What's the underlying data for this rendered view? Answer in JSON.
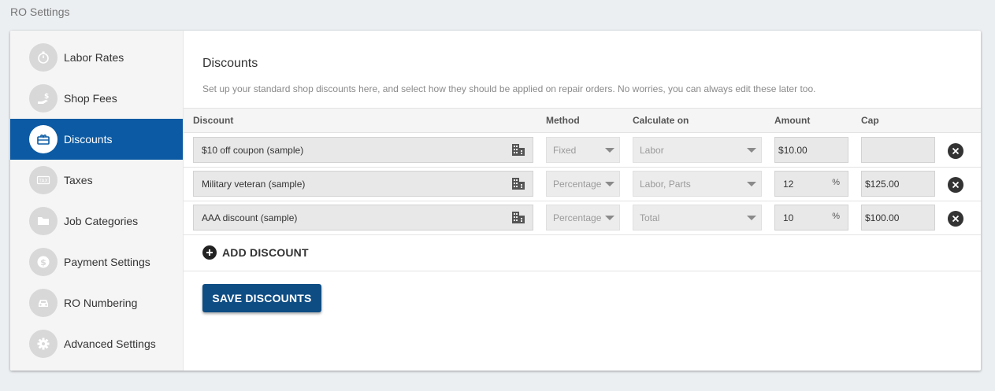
{
  "page": {
    "title": "RO Settings"
  },
  "sidebar": {
    "items": [
      {
        "label": "Labor Rates",
        "icon": "stopwatch-icon",
        "active": false
      },
      {
        "label": "Shop Fees",
        "icon": "hand-dollar-icon",
        "active": false
      },
      {
        "label": "Discounts",
        "icon": "coupon-icon",
        "active": true
      },
      {
        "label": "Taxes",
        "icon": "tax-icon",
        "active": false
      },
      {
        "label": "Job Categories",
        "icon": "folder-icon",
        "active": false
      },
      {
        "label": "Payment Settings",
        "icon": "dollar-coin-icon",
        "active": false
      },
      {
        "label": "RO Numbering",
        "icon": "car-icon",
        "active": false
      },
      {
        "label": "Advanced Settings",
        "icon": "gear-icon",
        "active": false
      }
    ],
    "tax_icon_text": "TAX"
  },
  "discounts": {
    "title": "Discounts",
    "description": "Set up your standard shop discounts here, and select how they should be applied on repair orders. No worries, you can always edit these later too.",
    "columns": {
      "discount": "Discount",
      "method": "Method",
      "calculate_on": "Calculate on",
      "amount": "Amount",
      "cap": "Cap"
    },
    "rows": [
      {
        "name": "$10 off coupon (sample)",
        "method": "Fixed",
        "calculate_on": "Labor",
        "amount_prefix": "$",
        "amount": "10.00",
        "amount_suffix": "",
        "cap": ""
      },
      {
        "name": "Military veteran (sample)",
        "method": "Percentage",
        "calculate_on": "Labor, Parts",
        "amount_prefix": "",
        "amount": "12",
        "amount_suffix": "%",
        "cap": "$125.00"
      },
      {
        "name": "AAA discount (sample)",
        "method": "Percentage",
        "calculate_on": "Total",
        "amount_prefix": "",
        "amount": "10",
        "amount_suffix": "%",
        "cap": "$100.00"
      }
    ],
    "add_label": "ADD DISCOUNT",
    "save_label": "SAVE DISCOUNTS"
  },
  "colors": {
    "accent": "#0b5aa3",
    "save_button": "#0e4d84"
  }
}
